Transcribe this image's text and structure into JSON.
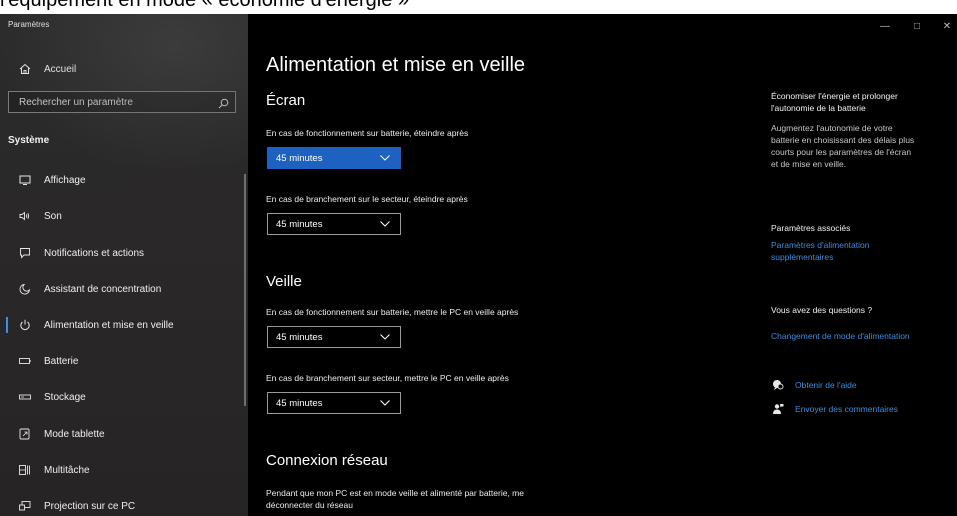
{
  "caption_text": "l'équipement en mode « économie d'énergie »",
  "window": {
    "title": "Paramètres",
    "controls": {
      "minimize": "—",
      "maximize": "□",
      "close": "✕"
    }
  },
  "sidebar": {
    "home_label": "Accueil",
    "search_placeholder": "Rechercher un paramètre",
    "section_label": "Système",
    "items": [
      {
        "label": "Affichage",
        "icon": "display-icon"
      },
      {
        "label": "Son",
        "icon": "speaker-icon"
      },
      {
        "label": "Notifications et actions",
        "icon": "notification-icon"
      },
      {
        "label": "Assistant de concentration",
        "icon": "moon-icon"
      },
      {
        "label": "Alimentation et mise en veille",
        "icon": "power-icon",
        "active": true
      },
      {
        "label": "Batterie",
        "icon": "battery-icon"
      },
      {
        "label": "Stockage",
        "icon": "storage-icon"
      },
      {
        "label": "Mode tablette",
        "icon": "tablet-icon"
      },
      {
        "label": "Multitâche",
        "icon": "multitask-icon"
      },
      {
        "label": "Projection sur ce PC",
        "icon": "projection-icon"
      }
    ]
  },
  "main": {
    "title": "Alimentation et mise en veille",
    "screen": {
      "heading": "Écran",
      "battery_label": "En cas de fonctionnement sur batterie, éteindre après",
      "battery_value": "45 minutes",
      "plugged_label": "En cas de branchement sur le secteur, éteindre après",
      "plugged_value": "45 minutes"
    },
    "sleep": {
      "heading": "Veille",
      "battery_label": "En cas de fonctionnement sur batterie, mettre le PC en veille après",
      "battery_value": "45 minutes",
      "plugged_label": "En cas de branchement sur secteur, mettre le PC en veille après",
      "plugged_value": "45 minutes"
    },
    "network": {
      "heading": "Connexion réseau",
      "description_line1": "Pendant que mon PC est en mode veille et alimenté par batterie, me",
      "description_line2": "déconnecter du réseau"
    }
  },
  "right_panel": {
    "save_heading_line1": "Économiser l'énergie et prolonger",
    "save_heading_line2": "l'autonomie de la batterie",
    "save_text_line1": "Augmentez l'autonomie de votre",
    "save_text_line2": "batterie en choisissant des délais plus",
    "save_text_line3": "courts pour les paramètres de l'écran",
    "save_text_line4": "et de mise en veille.",
    "related_heading": "Paramètres associés",
    "related_link_line1": "Paramètres d'alimentation",
    "related_link_line2": "supplémentaires",
    "questions_heading": "Vous avez des questions ?",
    "questions_link": "Changement de mode d'alimentation",
    "help_link": "Obtenir de l'aide",
    "feedback_link": "Envoyer des commentaires"
  },
  "colors": {
    "accent": "#1d62c0",
    "link": "#3b8de0",
    "background": "#000000",
    "sidebar": "#2b2929"
  }
}
